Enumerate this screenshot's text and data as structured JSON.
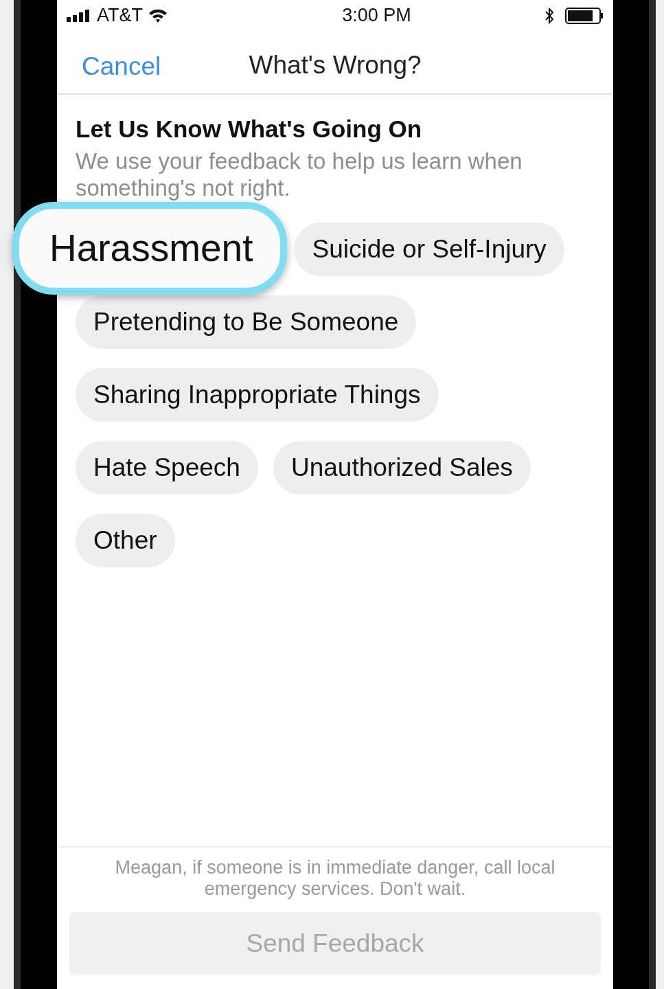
{
  "status_bar": {
    "carrier": "AT&T",
    "time": "3:00 PM"
  },
  "nav": {
    "cancel": "Cancel",
    "title": "What's Wrong?"
  },
  "heading": "Let Us Know What's Going On",
  "subtitle": "We use your feedback to help us learn when something's not right.",
  "options": [
    {
      "label": "Harassment",
      "highlighted": true
    },
    {
      "label": "Suicide or Self-Injury",
      "highlighted": false
    },
    {
      "label": "Pretending to Be Someone",
      "highlighted": false
    },
    {
      "label": "Sharing Inappropriate Things",
      "highlighted": false
    },
    {
      "label": "Hate Speech",
      "highlighted": false
    },
    {
      "label": "Unauthorized Sales",
      "highlighted": false
    },
    {
      "label": "Other",
      "highlighted": false
    }
  ],
  "footer_note": "Meagan, if someone is in immediate danger, call local emergency services. Don't wait.",
  "send_button": {
    "label": "Send Feedback",
    "disabled": true
  }
}
